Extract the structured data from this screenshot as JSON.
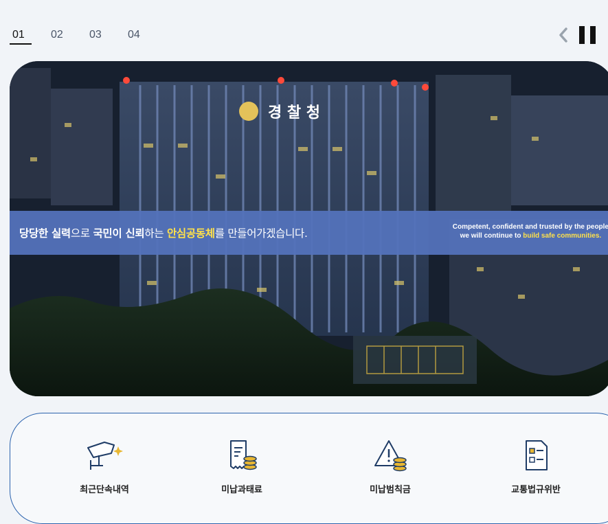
{
  "pager": {
    "tabs": [
      "01",
      "02",
      "03",
      "04"
    ],
    "active_index": 0
  },
  "controls": {
    "prev_icon": "chevron-left-icon",
    "pause_icon": "pause-icon"
  },
  "hero": {
    "sign_text": "경 찰 청",
    "headline": {
      "part1": "당당한 실력",
      "part2": "으로 ",
      "part3": "국민이 신뢰",
      "part4": "하는 ",
      "part5": "안심공동체",
      "part6": "를 만들어가겠습니다."
    },
    "english": {
      "line1": "Competent, confident and trusted by the people",
      "line2_pre": "we will continue to ",
      "line2_hl": "build safe communities."
    }
  },
  "services": [
    {
      "label": "최근단속내역",
      "icon": "cctv-camera-icon"
    },
    {
      "label": "미납과태료",
      "icon": "receipt-coins-icon"
    },
    {
      "label": "미납범칙금",
      "icon": "warning-coins-icon"
    },
    {
      "label": "교통법규위반",
      "icon": "checklist-document-icon"
    }
  ],
  "colors": {
    "accent": "#2a62ad",
    "highlight": "#ffe14a",
    "gold": "#e8b732",
    "strip": "#5372ba"
  }
}
